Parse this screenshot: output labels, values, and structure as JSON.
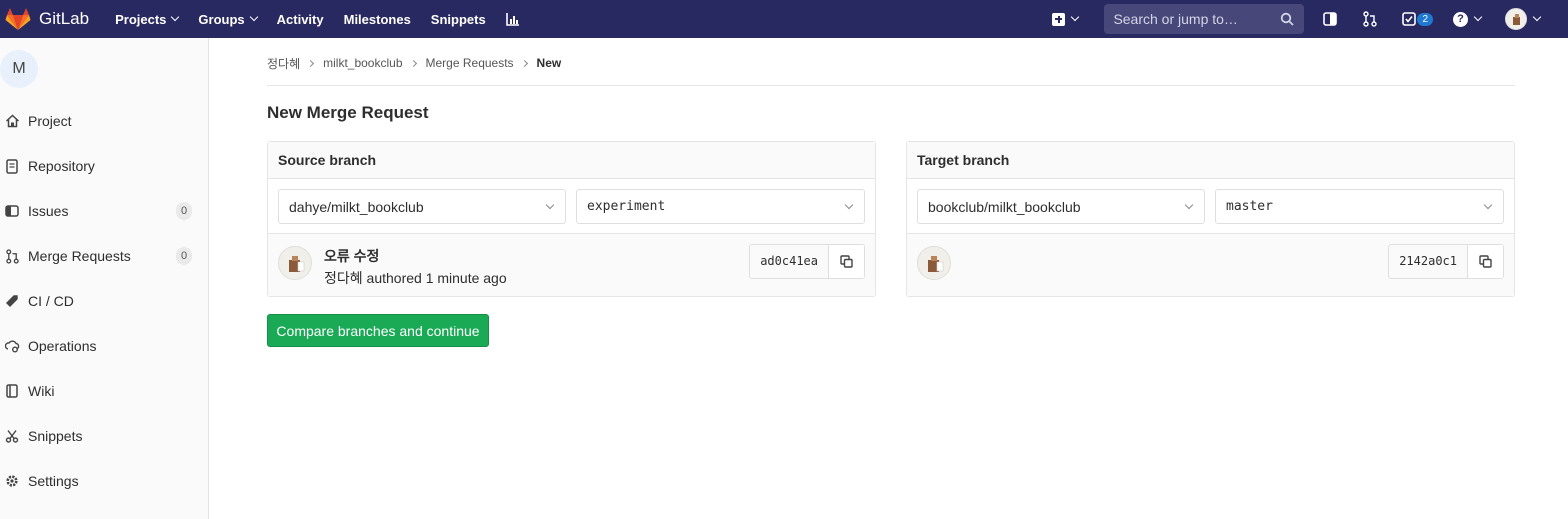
{
  "navbar": {
    "brand": "GitLab",
    "links": [
      {
        "label": "Projects",
        "dropdown": true
      },
      {
        "label": "Groups",
        "dropdown": true
      },
      {
        "label": "Activity",
        "dropdown": false
      },
      {
        "label": "Milestones",
        "dropdown": false
      },
      {
        "label": "Snippets",
        "dropdown": false
      }
    ],
    "search_placeholder": "Search or jump to…",
    "todo_count": "2",
    "help_glyph": "?",
    "colors": {
      "bg": "#292961",
      "accent": "#1f78d1"
    }
  },
  "sidebar": {
    "project_initial": "M",
    "items": [
      {
        "label": "Project",
        "icon": "home-icon",
        "count": null
      },
      {
        "label": "Repository",
        "icon": "doc-icon",
        "count": null
      },
      {
        "label": "Issues",
        "icon": "issues-icon",
        "count": "0"
      },
      {
        "label": "Merge Requests",
        "icon": "merge-request-icon",
        "count": "0"
      },
      {
        "label": "CI / CD",
        "icon": "rocket-icon",
        "count": null
      },
      {
        "label": "Operations",
        "icon": "cloud-gear-icon",
        "count": null
      },
      {
        "label": "Wiki",
        "icon": "book-icon",
        "count": null
      },
      {
        "label": "Snippets",
        "icon": "scissors-icon",
        "count": null
      },
      {
        "label": "Settings",
        "icon": "gear-icon",
        "count": null
      }
    ]
  },
  "breadcrumb": {
    "items": [
      "정다혜",
      "milkt_bookclub",
      "Merge Requests"
    ],
    "current": "New"
  },
  "page": {
    "title": "New Merge Request",
    "compare_button": "Compare branches and continue",
    "compare_color": "#1aaa55"
  },
  "source": {
    "heading": "Source branch",
    "project": "dahye/milkt_bookclub",
    "branch": "experiment",
    "commit_title": "오류 수정",
    "commit_meta": "정다혜 authored 1 minute ago",
    "sha": "ad0c41ea"
  },
  "target": {
    "heading": "Target branch",
    "project": "bookclub/milkt_bookclub",
    "branch": "master",
    "sha": "2142a0c1"
  }
}
